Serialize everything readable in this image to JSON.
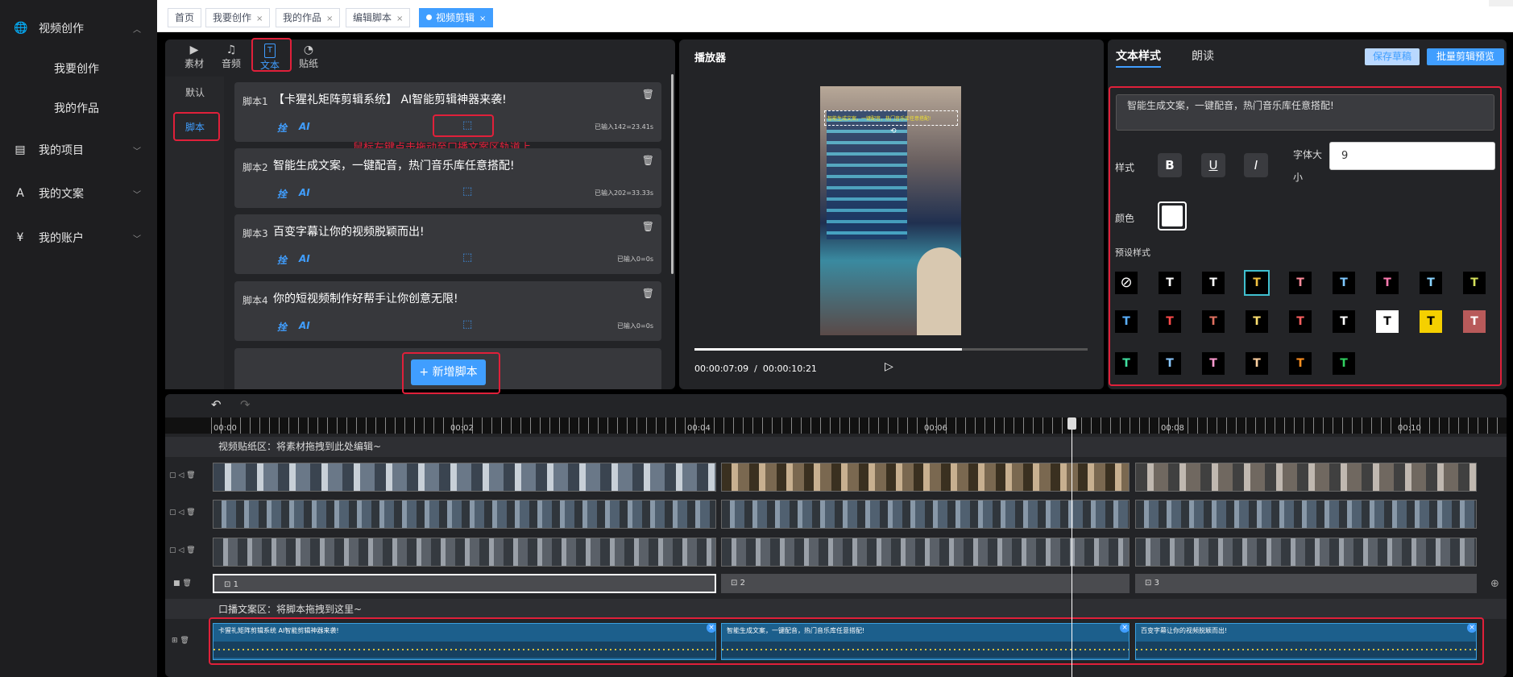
{
  "sidebar": {
    "items": [
      {
        "label": "视频创作",
        "icon": "globe-icon",
        "glyph": "🌐"
      },
      {
        "label": "我的项目",
        "icon": "document-icon",
        "glyph": "▤"
      },
      {
        "label": "我的文案",
        "icon": "text-icon",
        "glyph": "A"
      },
      {
        "label": "我的账户",
        "icon": "yen-icon",
        "glyph": "¥"
      }
    ],
    "subitems": [
      "我要创作",
      "我的作品"
    ]
  },
  "tabs": [
    {
      "label": "首页"
    },
    {
      "label": "我要创作",
      "close": "×"
    },
    {
      "label": "我的作品",
      "close": "×"
    },
    {
      "label": "编辑脚本",
      "close": "×"
    },
    {
      "label": "视频剪辑",
      "close": "×"
    }
  ],
  "left_panel": {
    "top_tabs": [
      {
        "label": "素材",
        "glyph": "▶"
      },
      {
        "label": "音频",
        "glyph": "♫"
      },
      {
        "label": "文本",
        "glyph": "T"
      },
      {
        "label": "贴纸",
        "glyph": "◔"
      }
    ],
    "side_tabs": [
      "默认",
      "脚本"
    ],
    "scripts": [
      {
        "no": "脚本1",
        "text": "【卡猩礼矩阵剪辑系统】 AI智能剪辑神器来袭!",
        "count": "已输入142=23.41s"
      },
      {
        "no": "脚本2",
        "text": "智能生成文案，一键配音，热门音乐库任意搭配!",
        "count": "已输入202=33.33s"
      },
      {
        "no": "脚本3",
        "text": "百变字幕让你的视频脱颖而出!",
        "count": "已输入0=0s"
      },
      {
        "no": "脚本4",
        "text": "你的短视频制作好帮手让你创意无限!",
        "count": "已输入0=0s"
      }
    ],
    "pen_label": "拴",
    "ai_label": "AI",
    "hint": "鼠标左键点击拖动至口播文案区轨道上",
    "add_button": "新增脚本",
    "add_icon": "+"
  },
  "player": {
    "title": "播放器",
    "current_time": "00:00:07:09",
    "separator": "/",
    "total_time": "00:00:10:21",
    "progress": 0.68,
    "overlay_caption": "智能生成文案，一键配音，热门音乐库任意搭配!"
  },
  "right_panel": {
    "tabs": [
      "文本样式",
      "朗读"
    ],
    "save_draft": "保存草稿",
    "batch_preview": "批量剪辑预览",
    "text_value": "智能生成文案，一键配音，热门音乐库任意搭配!",
    "style_label": "样式",
    "bold": "B",
    "underline": "U",
    "italic": "I",
    "font_size_label_1": "字体大",
    "font_size_label_2": "小",
    "font_size_value": "9",
    "color_label": "颜色",
    "text_color": "#ffffff",
    "preset_label": "预设样式",
    "preset_glyph": "T",
    "preset_none": "⊘",
    "presets": [
      {
        "fg": "#ffffff",
        "bg": "#000000"
      },
      {
        "fg": "#ffffff",
        "bg": "#000000"
      },
      {
        "fg": "#f0c040",
        "bg": "#000000"
      },
      {
        "fg": "#ff8a9a",
        "bg": "#000000"
      },
      {
        "fg": "#7ec8ff",
        "bg": "#000000"
      },
      {
        "fg": "#ff7ab0",
        "bg": "#000000"
      },
      {
        "fg": "#8ad4ff",
        "bg": "#000000"
      },
      {
        "fg": "#d4e05a",
        "bg": "#000000"
      },
      {
        "fg": "#5ab0ff",
        "bg": "#000000"
      },
      {
        "fg": "#ff4a4a",
        "bg": "#000000"
      },
      {
        "fg": "#e07060",
        "bg": "#000000"
      },
      {
        "fg": "#ffe070",
        "bg": "#000000"
      },
      {
        "fg": "#ff6060",
        "bg": "#000000"
      },
      {
        "fg": "#ffffff",
        "bg": "#000000"
      },
      {
        "fg": "#000000",
        "bg": "#ffffff"
      },
      {
        "fg": "#000000",
        "bg": "#f5d000"
      },
      {
        "fg": "#ffffff",
        "bg": "#b85a5a"
      },
      {
        "fg": "#40e0a0",
        "bg": "#000000"
      },
      {
        "fg": "#8ac8ff",
        "bg": "#000000"
      },
      {
        "fg": "#ff9ad0",
        "bg": "#000000"
      },
      {
        "fg": "#ffd0a0",
        "bg": "#000000"
      },
      {
        "fg": "#ff9020",
        "bg": "#000000"
      },
      {
        "fg": "#30d060",
        "bg": "#000000"
      }
    ]
  },
  "timeline": {
    "ticks": [
      "00:00",
      "00:02",
      "00:04",
      "00:06",
      "00:08",
      "00:10"
    ],
    "playhead_fraction": 0.68,
    "sticker_label": "视频贴纸区：将素材拖拽到此处编辑~",
    "subs": [
      "1",
      "2",
      "3"
    ],
    "voiceover_label": "口播文案区：将脚本拖拽到这里~",
    "captions": [
      "卡猩礼矩阵剪辑系统 AI智能剪辑神器来袭!",
      "智能生成文案，一键配音，热门音乐库任意搭配!",
      "百变字幕让你的视频脱颖而出!"
    ],
    "undo": "↶",
    "redo": "↷",
    "add_track": "⊕"
  }
}
